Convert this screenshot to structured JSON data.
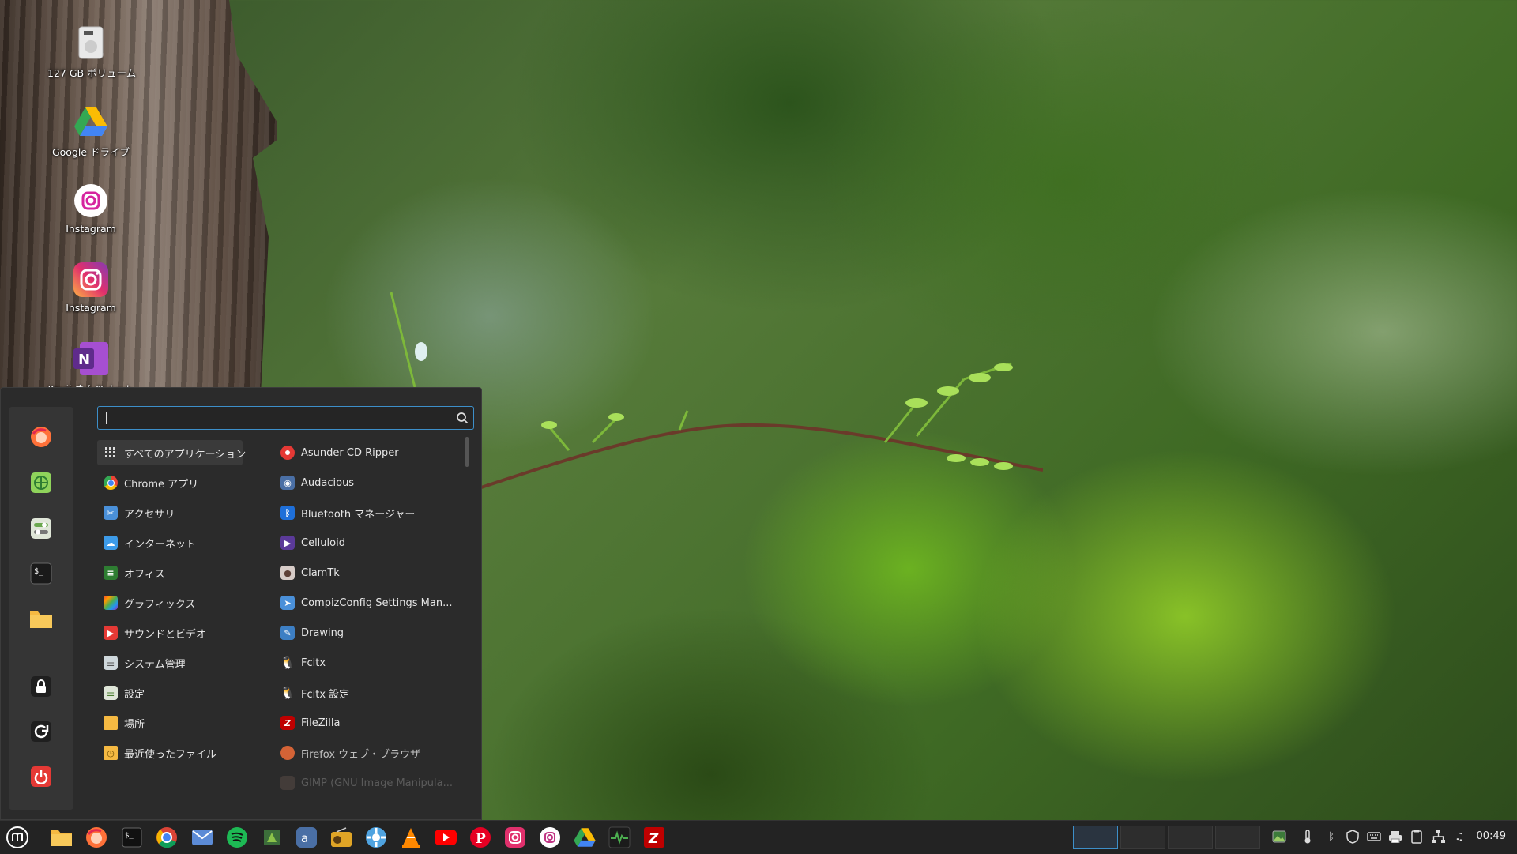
{
  "desktop_icons": [
    {
      "name": "drive-icon",
      "label": "127 GB ボリューム"
    },
    {
      "name": "google-drive-icon",
      "label": "Google ドライブ"
    },
    {
      "name": "instagram-white-icon",
      "label": "Instagram"
    },
    {
      "name": "instagram-color-icon",
      "label": "Instagram"
    },
    {
      "name": "onenote-icon",
      "label": "Kouji さんのノート"
    }
  ],
  "menu": {
    "search_value": "",
    "favorites": [
      "firefox-icon",
      "chrome-apps-icon",
      "settings-icon",
      "terminal-icon",
      "folder-icon",
      "lock-icon",
      "logout-icon",
      "power-icon"
    ],
    "categories": [
      {
        "label": "すべてのアプリケーション",
        "icon": "grid-icon"
      },
      {
        "label": "Chrome アプリ",
        "icon": "chrome-icon"
      },
      {
        "label": "アクセサリ",
        "icon": "accessories-icon"
      },
      {
        "label": "インターネット",
        "icon": "internet-icon"
      },
      {
        "label": "オフィス",
        "icon": "office-icon"
      },
      {
        "label": "グラフィックス",
        "icon": "graphics-icon"
      },
      {
        "label": "サウンドとビデオ",
        "icon": "sound-video-icon"
      },
      {
        "label": "システム管理",
        "icon": "system-admin-icon"
      },
      {
        "label": "設定",
        "icon": "settings-icon"
      },
      {
        "label": "場所",
        "icon": "places-icon"
      },
      {
        "label": "最近使ったファイル",
        "icon": "recent-files-icon"
      }
    ],
    "apps": [
      {
        "label": "Asunder CD Ripper",
        "icon": "asunder-icon"
      },
      {
        "label": "Audacious",
        "icon": "audacious-icon"
      },
      {
        "label": "Bluetooth マネージャー",
        "icon": "bluetooth-icon"
      },
      {
        "label": "Celluloid",
        "icon": "celluloid-icon"
      },
      {
        "label": "ClamTk",
        "icon": "clamtk-icon"
      },
      {
        "label": "CompizConfig Settings Man...",
        "icon": "compizconfig-icon"
      },
      {
        "label": "Drawing",
        "icon": "drawing-icon"
      },
      {
        "label": "Fcitx",
        "icon": "fcitx-icon"
      },
      {
        "label": "Fcitx 設定",
        "icon": "fcitx-settings-icon"
      },
      {
        "label": "FileZilla",
        "icon": "filezilla-icon"
      },
      {
        "label": "Firefox ウェブ・ブラウザ",
        "icon": "firefox-icon"
      },
      {
        "label": "GIMP (GNU Image Manipula...",
        "icon": "gimp-icon"
      }
    ]
  },
  "taskbar": {
    "apps": [
      "menu-icon",
      "files-icon",
      "firefox-icon",
      "terminal-icon",
      "chrome-icon",
      "mail-icon",
      "spotify-icon",
      "puzzle-icon",
      "audacious-icon",
      "radio-icon",
      "settings-flower-icon",
      "vlc-icon",
      "youtube-icon",
      "pinterest-icon",
      "instagram-icon",
      "instagram-white-icon",
      "google-drive-icon",
      "system-monitor-icon",
      "filezilla-icon"
    ],
    "workspaces": 4,
    "active_workspace": 1,
    "tray": [
      "image-viewer-icon",
      "thermometer-icon",
      "bluetooth-icon",
      "shield-icon",
      "keyboard-icon",
      "printer-icon",
      "clipboard-icon",
      "network-icon",
      "sound-icon"
    ],
    "clock": "00:49"
  }
}
